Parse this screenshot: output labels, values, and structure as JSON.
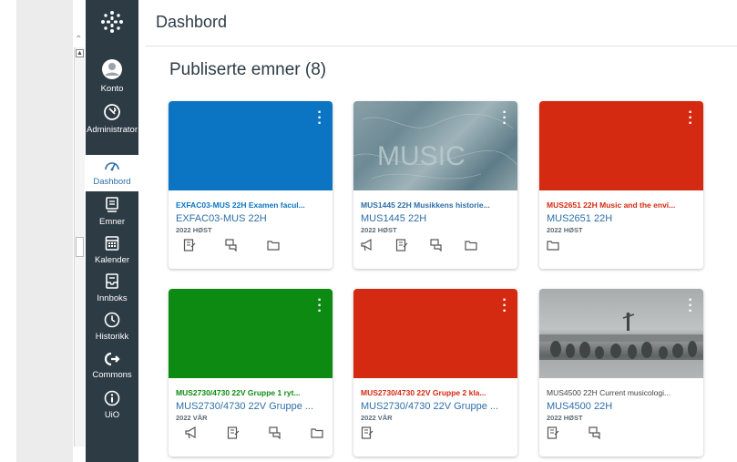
{
  "nav": {
    "items": [
      {
        "label": "Konto",
        "icon": "account-icon"
      },
      {
        "label": "Administrator",
        "icon": "admin-icon"
      },
      {
        "label": "Dashbord",
        "icon": "dashboard-icon",
        "active": true
      },
      {
        "label": "Emner",
        "icon": "courses-icon"
      },
      {
        "label": "Kalender",
        "icon": "calendar-icon"
      },
      {
        "label": "Innboks",
        "icon": "inbox-icon"
      },
      {
        "label": "Historikk",
        "icon": "history-icon"
      },
      {
        "label": "Commons",
        "icon": "commons-icon"
      },
      {
        "label": "UiO",
        "icon": "help-icon"
      }
    ]
  },
  "header": {
    "title": "Dashbord"
  },
  "section": {
    "title": "Publiserte emner (8)"
  },
  "cards": [
    {
      "code": "EXFAC03-MUS 22H Examen facul...",
      "short": "EXFAC03-MUS 22H",
      "term": "2022 HØST",
      "color": "#0b75c4",
      "code_color": "#0b75c4",
      "icons": [
        "assignments-icon",
        "discussions-icon",
        "files-icon"
      ]
    },
    {
      "code": "MUS1445 22H Musikkens historie...",
      "short": "MUS1445 22H",
      "term": "2022 HØST",
      "color": "#7d98a0",
      "code_color": "#2d6ea8",
      "icons": [
        "announcements-icon",
        "assignments-icon",
        "discussions-icon",
        "files-icon"
      ]
    },
    {
      "code": "MUS2651 22H Music and the envi...",
      "short": "MUS2651 22H",
      "term": "2022 HØST",
      "color": "#d42a12",
      "code_color": "#d42a12",
      "icons": [
        "files-icon"
      ]
    },
    {
      "code": "MUS2730/4730 22V Gruppe 1 ryt...",
      "short": "MUS2730/4730 22V Gruppe ...",
      "term": "2022 VÅR",
      "color": "#0d8a12",
      "code_color": "#0d8a12",
      "icons": [
        "announcements-icon",
        "assignments-icon",
        "discussions-icon",
        "files-icon"
      ]
    },
    {
      "code": "MUS2730/4730 22V Gruppe 2 kla...",
      "short": "MUS2730/4730 22V Gruppe ...",
      "term": "2022 VÅR",
      "color": "#d42a12",
      "code_color": "#d42a12",
      "icons": [
        "assignments-icon"
      ]
    },
    {
      "code": "MUS4500 22H Current musicologi...",
      "short": "MUS4500 22H",
      "term": "2022 HØST",
      "color": "#8a8e8e",
      "code_color": "#444444",
      "icons": [
        "assignments-icon",
        "discussions-icon"
      ]
    }
  ],
  "hero_text": {
    "music": "MUSIC"
  }
}
